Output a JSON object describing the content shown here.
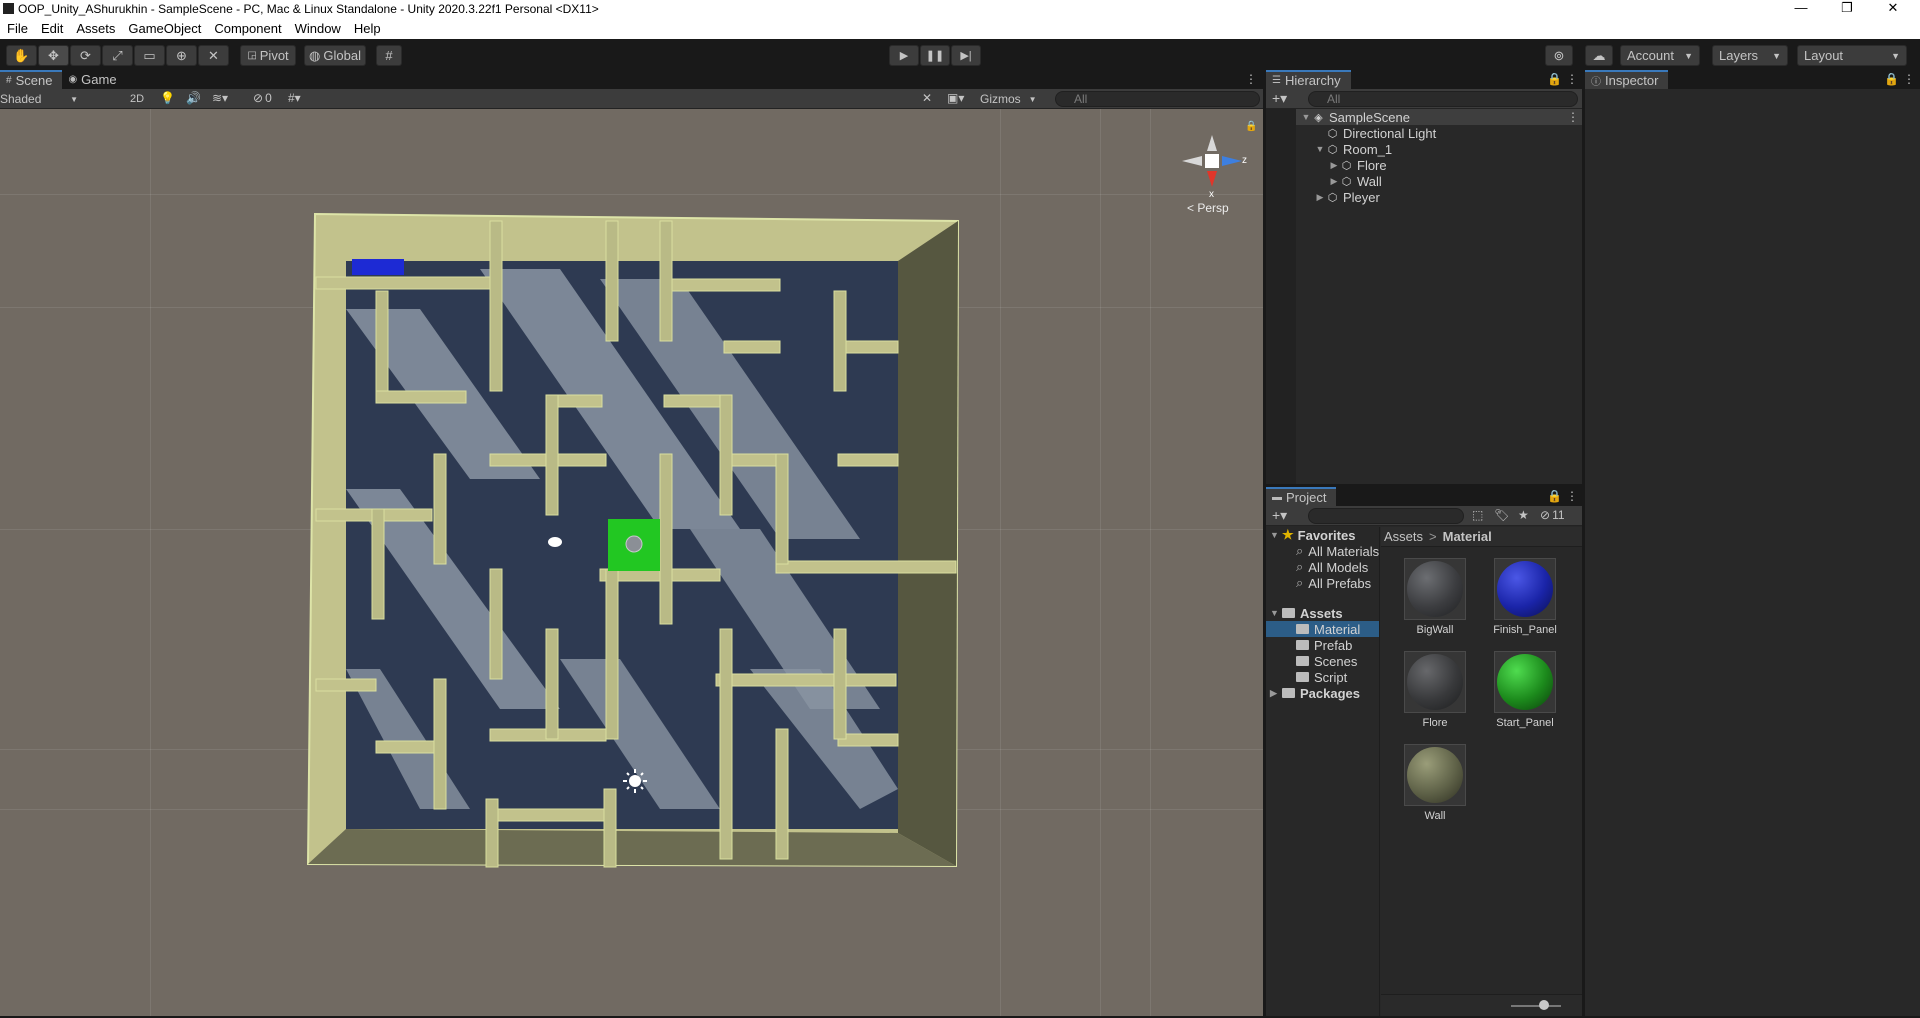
{
  "window": {
    "title": "OOP_Unity_AShurukhin - SampleScene - PC, Mac & Linux Standalone - Unity 2020.3.22f1 Personal <DX11>",
    "minimize": "—",
    "maximize": "❐",
    "close": "✕"
  },
  "menu": [
    "File",
    "Edit",
    "Assets",
    "GameObject",
    "Component",
    "Window",
    "Help"
  ],
  "toolbar": {
    "pivot_label": "Pivot",
    "global_label": "Global",
    "account_label": "Account",
    "layers_label": "Layers",
    "layout_label": "Layout",
    "play_icon": "play-icon",
    "pause_icon": "pause-icon",
    "step_icon": "step-icon"
  },
  "scene_panel": {
    "tabs": [
      "Scene",
      "Game"
    ],
    "shading_mode": "Shaded",
    "mode_2d": "2D",
    "hidden_count": "0",
    "gizmos_label": "Gizmos",
    "search_placeholder": "All",
    "persp_label": "< Persp",
    "gizmo_axis_z": "z",
    "gizmo_axis_x": "x"
  },
  "hierarchy": {
    "tab_label": "Hierarchy",
    "search_placeholder": "All",
    "items": [
      {
        "label": "SampleScene",
        "depth": 0,
        "arrow": "▼",
        "icon": "unity-scene-icon"
      },
      {
        "label": "Directional Light",
        "depth": 1,
        "arrow": "",
        "icon": "gameobject-cube-icon"
      },
      {
        "label": "Room_1",
        "depth": 1,
        "arrow": "▼",
        "icon": "gameobject-cube-icon"
      },
      {
        "label": "Flore",
        "depth": 2,
        "arrow": "▶",
        "icon": "gameobject-cube-icon"
      },
      {
        "label": "Wall",
        "depth": 2,
        "arrow": "▶",
        "icon": "gameobject-cube-icon"
      },
      {
        "label": "Pleyer",
        "depth": 1,
        "arrow": "▶",
        "icon": "gameobject-cube-icon"
      }
    ]
  },
  "inspector": {
    "tab_label": "Inspector"
  },
  "project": {
    "tab_label": "Project",
    "hidden_count": "11",
    "favorites": {
      "label": "Favorites",
      "items": [
        "All Materials",
        "All Models",
        "All Prefabs"
      ]
    },
    "assets": {
      "label": "Assets",
      "items": [
        "Material",
        "Prefab",
        "Scenes",
        "Script"
      ]
    },
    "packages_label": "Packages",
    "breadcrumb": {
      "root": "Assets",
      "separator": ">",
      "current": "Material"
    },
    "materials": [
      {
        "name": "BigWall",
        "color": "#3c3d40"
      },
      {
        "name": "Finish_Panel",
        "color": "#1a24a8"
      },
      {
        "name": "Flore",
        "color": "#38393b"
      },
      {
        "name": "Start_Panel",
        "color": "#1c8a1c"
      },
      {
        "name": "Wall",
        "color": "#5f6248"
      }
    ]
  },
  "colors": {
    "accent": "#3a79bb",
    "maze_wall": "#c2c28c",
    "maze_floor": "#2e3a52",
    "start_panel": "#22c722",
    "finish_panel": "#1d2ad4"
  }
}
